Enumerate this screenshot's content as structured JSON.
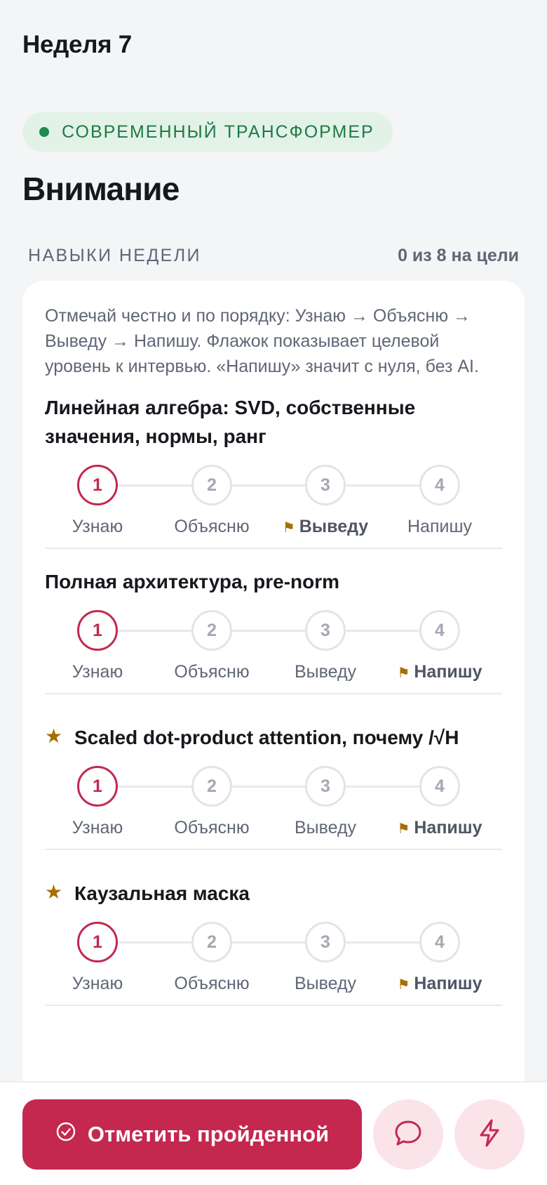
{
  "header": {
    "week": "Неделя 7",
    "track_badge": "СОВРЕМЕННЫЙ ТРАНСФОРМЕР",
    "topic": "Внимание"
  },
  "skills_section": {
    "label": "НАВЫКИ НЕДЕЛИ",
    "progress": "0 из 8 на цели",
    "intro": "Отмечай честно и по порядку: Узнаю → Объясню → Выведу → Напишу. Флажок показывает целевой уровень к интервью. «Напишу» значит с нуля, без AI.",
    "levels": [
      "Узнаю",
      "Объясню",
      "Выведу",
      "Напишу"
    ],
    "step_numbers": [
      "1",
      "2",
      "3",
      "4"
    ],
    "skills": [
      {
        "name": "Линейная алгебра: SVD, собственные значения, нормы, ранг",
        "starred": false,
        "current_level": 1,
        "target_level": 3
      },
      {
        "name": "Полная архитектура, pre-norm",
        "starred": false,
        "current_level": 1,
        "target_level": 4
      },
      {
        "name": "Scaled dot-product attention, почему /√H",
        "starred": true,
        "current_level": 1,
        "target_level": 4
      },
      {
        "name": "Каузальная маска",
        "starred": true,
        "current_level": 1,
        "target_level": 4
      }
    ]
  },
  "actions": {
    "mark_done": "Отметить пройденной"
  },
  "icons": {
    "star": "star-icon",
    "flag": "flag-icon",
    "check": "check-circle-icon",
    "chat": "chat-bubble-icon",
    "lightning": "lightning-icon"
  },
  "colors": {
    "accent": "#c4284f",
    "badge_bg": "#e2f2e7",
    "badge_text": "#1e7a45",
    "flag": "#a66f00",
    "round_button_bg": "#fbe3ea"
  }
}
